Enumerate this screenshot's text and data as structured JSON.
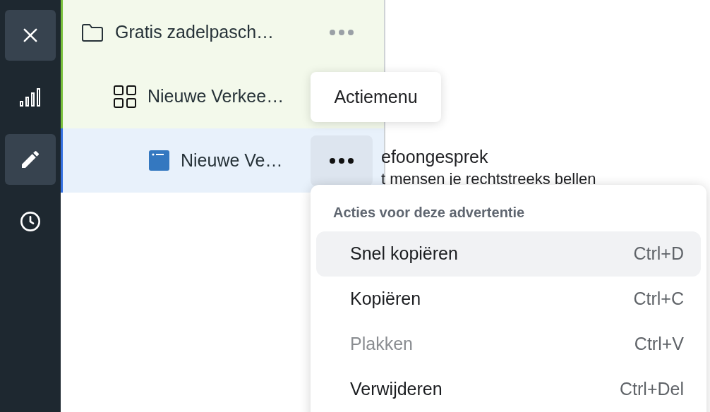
{
  "sidebar": {
    "items": [
      {
        "kind": "close",
        "selected": true
      },
      {
        "kind": "chart",
        "selected": false
      },
      {
        "kind": "edit",
        "selected": true
      },
      {
        "kind": "history",
        "selected": false
      }
    ]
  },
  "tree": [
    {
      "kind": "folder",
      "label": "Gratis zadelpasch…",
      "selected": false,
      "more_button": true,
      "menu_open": false,
      "children": [
        {
          "kind": "grid",
          "label": "Nieuwe Verkee…",
          "selected": false,
          "more_button": false,
          "children": [
            {
              "kind": "ad",
              "label": "Nieuwe Ve…",
              "selected": true,
              "more_button": true,
              "menu_open": true
            }
          ]
        }
      ]
    }
  ],
  "content": {
    "title": "efoongesprek",
    "subtitle": "t mensen je rechtstreeks bellen"
  },
  "tooltip": "Actiemenu",
  "menu": {
    "header": "Acties voor deze advertentie",
    "items": [
      {
        "label": "Snel kopiëren",
        "shortcut": "Ctrl+D",
        "selected": true,
        "disabled": false
      },
      {
        "label": "Kopiëren",
        "shortcut": "Ctrl+C",
        "selected": false,
        "disabled": false
      },
      {
        "label": "Plakken",
        "shortcut": "Ctrl+V",
        "selected": false,
        "disabled": true
      },
      {
        "label": "Verwijderen",
        "shortcut": "Ctrl+Del",
        "selected": false,
        "disabled": false
      }
    ]
  }
}
